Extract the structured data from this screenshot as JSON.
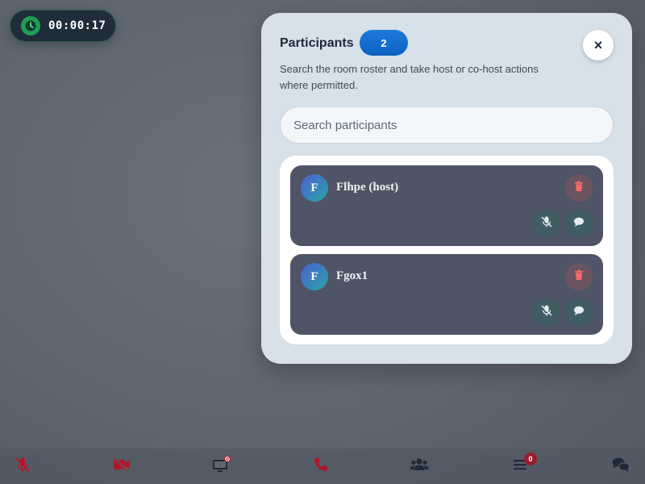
{
  "timer": {
    "elapsed": "00:00:17"
  },
  "panel": {
    "title": "Participants",
    "count": "2",
    "close_label": "×",
    "description": "Search the room roster and take host or co-host actions where permitted.",
    "search": {
      "placeholder": "Search participants",
      "value": ""
    },
    "participants": [
      {
        "initial": "F",
        "name": "Flhpe (host)"
      },
      {
        "initial": "F",
        "name": "Fgox1"
      }
    ]
  },
  "toolbar": {
    "items": [
      {
        "icon": "mic-muted-icon"
      },
      {
        "icon": "video-off-icon"
      },
      {
        "icon": "screen-share-disabled-icon"
      },
      {
        "icon": "hang-up-icon"
      },
      {
        "icon": "participants-icon"
      },
      {
        "icon": "menu-icon",
        "badge": "0"
      },
      {
        "icon": "chat-icon"
      }
    ]
  },
  "colors": {
    "accent": "#0b61c3",
    "danger": "#b0182a",
    "timer_green": "#1f9d55"
  }
}
